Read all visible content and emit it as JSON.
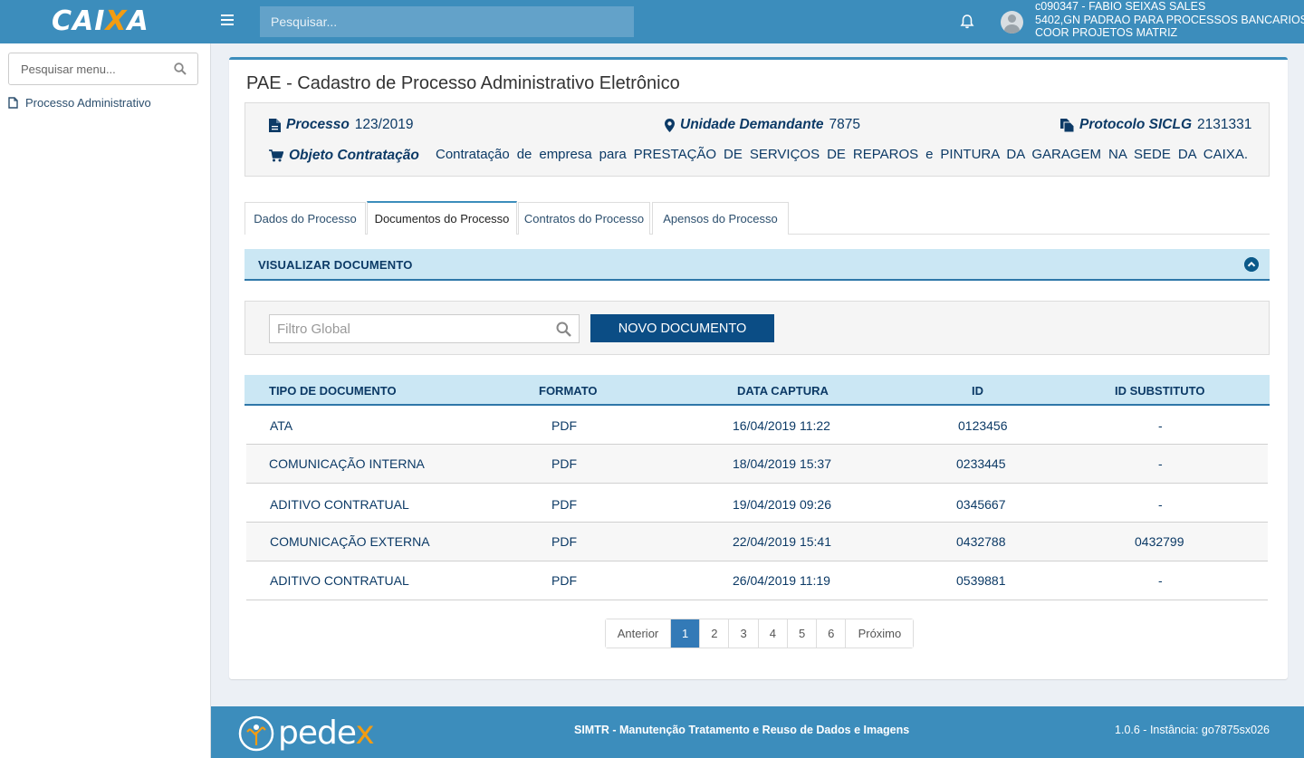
{
  "header": {
    "logo": "CAIXA",
    "search_placeholder": "Pesquisar...",
    "user_line1": "c090347 - FABIO SEIXAS SALES",
    "user_line2": "5402,GN PADRAO PARA PROCESSOS BANCARIOS",
    "user_line3": "COOR PROJETOS MATRIZ"
  },
  "sidebar": {
    "search_placeholder": "Pesquisar menu...",
    "items": [
      {
        "label": "Processo Administrativo"
      }
    ]
  },
  "page": {
    "title": "PAE - Cadastro de Processo Administrativo Eletrônico"
  },
  "process_info": {
    "processo_label": "Processo",
    "processo_value": "123/2019",
    "unidade_label": "Unidade Demandante",
    "unidade_value": "7875",
    "protocolo_label": "Protocolo SICLG",
    "protocolo_value": "2131331",
    "objeto_label": "Objeto Contratação",
    "objeto_value": "Contratação de empresa para PRESTAÇÃO DE SERVIÇOS DE REPAROS e PINTURA DA GARAGEM NA SEDE DA CAIXA."
  },
  "tabs": [
    {
      "label": "Dados do Processo"
    },
    {
      "label": "Documentos do Processo"
    },
    {
      "label": "Contratos do Processo"
    },
    {
      "label": "Apensos do Processo"
    }
  ],
  "section_title": "VISUALIZAR DOCUMENTO",
  "filter": {
    "placeholder": "Filtro Global",
    "new_button": "NOVO DOCUMENTO"
  },
  "table": {
    "headers": [
      "TIPO DE DOCUMENTO",
      "FORMATO",
      "DATA CAPTURA",
      "ID",
      "ID SUBSTITUTO"
    ],
    "rows": [
      [
        "ATA",
        "PDF",
        "16/04/2019 11:22",
        "0123456",
        "-"
      ],
      [
        "COMUNICAÇÃO INTERNA",
        "PDF",
        "18/04/2019 15:37",
        "0233445",
        "-"
      ],
      [
        "ADITIVO CONTRATUAL",
        "PDF",
        "19/04/2019 09:26",
        "0345667",
        "-"
      ],
      [
        "COMUNICAÇÃO EXTERNA",
        "PDF",
        "22/04/2019 15:41",
        "0432788",
        "0432799"
      ],
      [
        "ADITIVO CONTRATUAL",
        "PDF",
        "26/04/2019 11:19",
        "0539881",
        "-"
      ]
    ]
  },
  "pagination": {
    "prev": "Anterior",
    "pages": [
      "1",
      "2",
      "3",
      "4",
      "5",
      "6"
    ],
    "next": "Próximo",
    "current": "1"
  },
  "footer": {
    "brand": "pedex",
    "text": "SIMTR - Manutenção Tratamento e Reuso de Dados e Imagens",
    "version": "1.0.6 - Instância: go7875sx026"
  }
}
